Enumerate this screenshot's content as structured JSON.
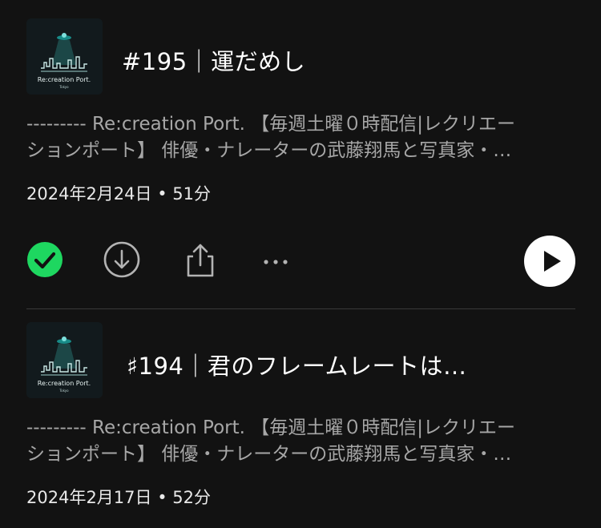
{
  "episodes": [
    {
      "title": "#195｜運だめし",
      "cover_label": "Re:creation Port.",
      "cover_sub": "Tokyo",
      "description_line1": "--------- Re:creation Port. 【毎週土曜０時配信|レクリエー",
      "description_line2": "ションポート】 俳優・ナレーターの武藤翔馬と写真家・…",
      "meta": "2024年2月24日 • 51分"
    },
    {
      "title": "♯194｜君のフレームレートは…",
      "cover_label": "Re:creation Port.",
      "cover_sub": "Tokyo",
      "description_line1": "--------- Re:creation Port. 【毎週土曜０時配信|レクリエー",
      "description_line2": "ションポート】 俳優・ナレーターの武藤翔馬と写真家・…",
      "meta": "2024年2月17日 • 52分"
    }
  ],
  "actions": {
    "played_icon": "check-circle-icon",
    "download_icon": "download-icon",
    "share_icon": "share-icon",
    "more_icon": "more-icon",
    "play_icon": "play-icon"
  },
  "colors": {
    "background": "#121212",
    "accent_green": "#1ed760",
    "secondary_text": "#a7a7a7"
  }
}
